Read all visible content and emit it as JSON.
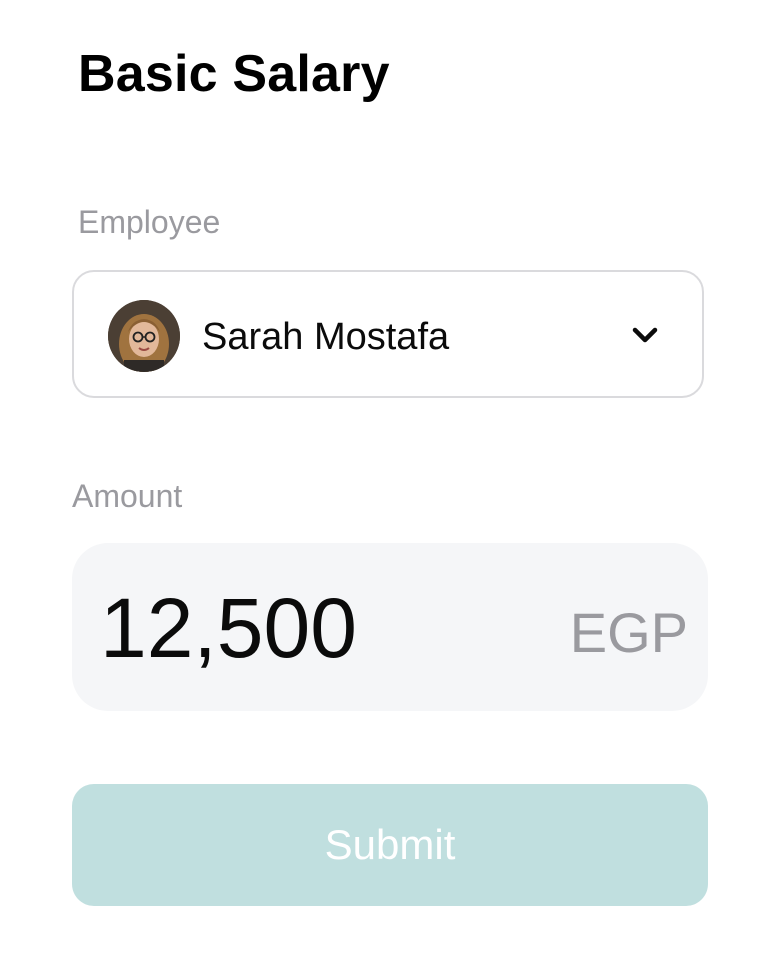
{
  "page": {
    "title": "Basic Salary"
  },
  "employee": {
    "label": "Employee",
    "selected_name": "Sarah Mostafa",
    "avatar": "employee-photo",
    "dropdown_icon": "chevron-down-icon"
  },
  "amount": {
    "label": "Amount",
    "value": "12,500",
    "currency": "EGP"
  },
  "submit": {
    "label": "Submit",
    "color": "#c0dfdf"
  }
}
